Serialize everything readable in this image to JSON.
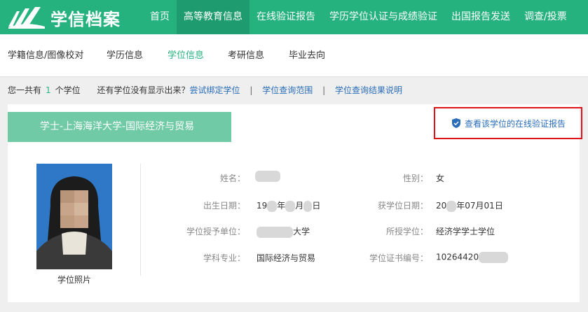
{
  "header": {
    "logo_text": "学信档案",
    "nav": [
      "首页",
      "高等教育信息",
      "在线验证报告",
      "学历学位认证与成绩验证",
      "出国报告发送",
      "调查/投票"
    ],
    "active_nav_index": 1
  },
  "subnav": {
    "items": [
      "学籍信息/图像校对",
      "学历信息",
      "学位信息",
      "考研信息",
      "毕业去向"
    ],
    "active_index": 2
  },
  "infoline": {
    "prefix": "您一共有",
    "count": "1",
    "suffix": "个学位",
    "question": "还有学位没有显示出来？",
    "bind_link": "尝试绑定学位",
    "sep1": "|",
    "scope_link": "学位查询范围",
    "sep2": "|",
    "explain_link": "学位查询结果说明"
  },
  "card": {
    "banner": "学士-上海海洋大学-国际经济与贸易",
    "verify_link": "查看该学位的在线验证报告",
    "photo_caption": "学位照片",
    "fields": {
      "name_label": "姓名：",
      "gender_label": "性别：",
      "gender_value": "女",
      "birth_label": "出生日期：",
      "birth_value_a": "19",
      "birth_value_b": "年",
      "birth_value_c": "月",
      "birth_value_d": "日",
      "award_date_label": "获学位日期：",
      "award_date_a": "20",
      "award_date_b": "年07月01日",
      "grantor_label": "学位授予单位：",
      "grantor_value": "大学",
      "degree_label": "所授学位：",
      "degree_value": "经济学学士学位",
      "major_label": "学科专业：",
      "major_value": "国际经济与贸易",
      "cert_label": "学位证书编号：",
      "cert_value": "10264420"
    }
  },
  "colors": {
    "brand_green": "#25b27f",
    "link_blue": "#2a6db8",
    "highlight_red": "#e0131b"
  }
}
